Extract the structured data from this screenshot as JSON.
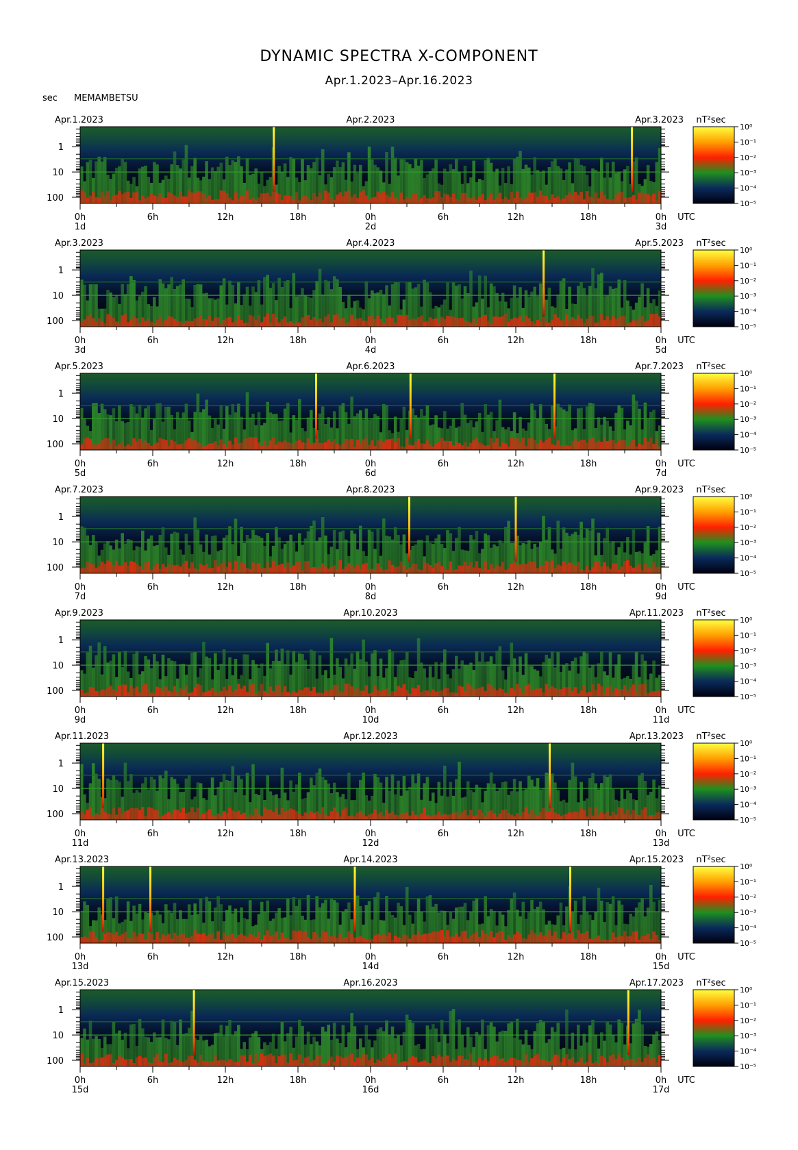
{
  "chart_data": {
    "type": "heatmap",
    "title": "DYNAMIC SPECTRA X-COMPONENT",
    "subtitle": "Apr.1.2023–Apr.16.2023",
    "station": "MEMAMBETSU",
    "ylabel": "sec",
    "y_scale": "log",
    "y_ticks": [
      "1",
      "10",
      "100"
    ],
    "x_ticks": [
      "0h",
      "6h",
      "12h",
      "18h",
      "0h",
      "6h",
      "12h",
      "18h",
      "0h"
    ],
    "x_unit": "UTC",
    "colorbar_unit": "nT²sec",
    "colorbar_ticks": [
      "10⁰",
      "10⁻¹",
      "10⁻²",
      "10⁻³",
      "10⁻⁴",
      "10⁻⁵"
    ],
    "colorscale": [
      "#ffff40",
      "#ffa000",
      "#ff2000",
      "#1f8f1f",
      "#0a2a5a",
      "#000010"
    ],
    "panels": [
      {
        "left_date": "Apr.1.2023",
        "mid_date": "Apr.2.2023",
        "right_date": "Apr.3.2023",
        "day_labels": [
          "1d",
          "2d",
          "3d"
        ],
        "spikes_h": [
          16,
          45.6
        ]
      },
      {
        "left_date": "Apr.3.2023",
        "mid_date": "Apr.4.2023",
        "right_date": "Apr.5.2023",
        "day_labels": [
          "3d",
          "4d",
          "5d"
        ],
        "spikes_h": [
          38.3
        ]
      },
      {
        "left_date": "Apr.5.2023",
        "mid_date": "Apr.6.2023",
        "right_date": "Apr.7.2023",
        "day_labels": [
          "5d",
          "6d",
          "7d"
        ],
        "spikes_h": [
          19.5,
          27.3,
          39.2
        ]
      },
      {
        "left_date": "Apr.7.2023",
        "mid_date": "Apr.8.2023",
        "right_date": "Apr.9.2023",
        "day_labels": [
          "7d",
          "8d",
          "9d"
        ],
        "spikes_h": [
          27.2,
          36
        ]
      },
      {
        "left_date": "Apr.9.2023",
        "mid_date": "Apr.10.2023",
        "right_date": "Apr.11.2023",
        "day_labels": [
          "9d",
          "10d",
          "11d"
        ],
        "spikes_h": []
      },
      {
        "left_date": "Apr.11.2023",
        "mid_date": "Apr.12.2023",
        "right_date": "Apr.13.2023",
        "day_labels": [
          "11d",
          "12d",
          "13d"
        ],
        "spikes_h": [
          1.9,
          38.8
        ]
      },
      {
        "left_date": "Apr.13.2023",
        "mid_date": "Apr.14.2023",
        "right_date": "Apr.15.2023",
        "day_labels": [
          "13d",
          "14d",
          "15d"
        ],
        "spikes_h": [
          1.9,
          5.8,
          22.7,
          40.5
        ]
      },
      {
        "left_date": "Apr.15.2023",
        "mid_date": "Apr.16.2023",
        "right_date": "Apr.17.2023",
        "day_labels": [
          "15d",
          "16d",
          "17d"
        ],
        "spikes_h": [
          9.4,
          45.3
        ]
      }
    ]
  }
}
